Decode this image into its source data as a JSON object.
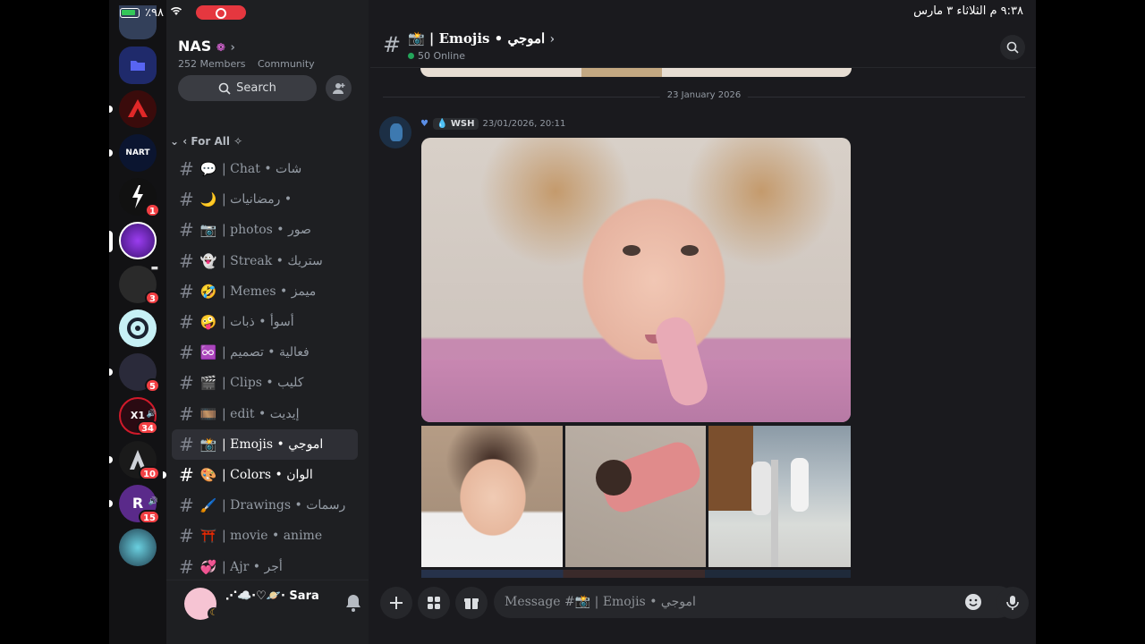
{
  "status_bar": {
    "battery": "٪٩٨",
    "datetime": "٩:٣٨ م  الثلاثاء ٣ مارس"
  },
  "servers": [
    {
      "icon": "folder-icon",
      "color": "#1f2a6b"
    },
    {
      "icon": "server-red",
      "color": "#2a0a0a"
    },
    {
      "icon": "server-nart",
      "color": "#0b1530"
    },
    {
      "icon": "server-1z20",
      "color": "#111",
      "badge": "1"
    },
    {
      "icon": "server-n",
      "color": "#6a2bc2"
    },
    {
      "icon": "server-dark",
      "color": "#2a2a2a",
      "badge": "3"
    },
    {
      "icon": "server-cyan",
      "color": "#c6f0f5"
    },
    {
      "icon": "server-rabbit",
      "color": "#2a2a3a",
      "badge": "5"
    },
    {
      "icon": "server-x1",
      "color": "#2a0a12",
      "badge": "34"
    },
    {
      "icon": "server-a",
      "color": "#1a1a1a",
      "badge": "10"
    },
    {
      "icon": "server-r",
      "color": "#5a2a8a",
      "badge": "15"
    },
    {
      "icon": "server-face",
      "color": "#1e3a4a"
    }
  ],
  "guild": {
    "name": "NAS",
    "members": "252 Members",
    "type": "Community",
    "search_label": "Search"
  },
  "category": "For All",
  "channels": [
    {
      "emoji": "💬",
      "name": "| Chat • شات",
      "state": "normal"
    },
    {
      "emoji": "🌙",
      "name": "| رمضانيات •",
      "state": "normal"
    },
    {
      "emoji": "📷",
      "name": "| photos • صور",
      "state": "normal"
    },
    {
      "emoji": "👻",
      "name": "| Streak • ستريك",
      "state": "normal"
    },
    {
      "emoji": "🤣",
      "name": "| Memes • ميمز",
      "state": "normal"
    },
    {
      "emoji": "🤪",
      "name": "| أسوأ • ذبات",
      "state": "normal"
    },
    {
      "emoji": "♾️",
      "name": "| فعالية • تصميم",
      "state": "normal"
    },
    {
      "emoji": "🎬",
      "name": "| Clips • كليب",
      "state": "normal"
    },
    {
      "emoji": "🎞️",
      "name": "| edit • إيديت",
      "state": "normal"
    },
    {
      "emoji": "📸",
      "name": "| Emojis • اموجي",
      "state": "active"
    },
    {
      "emoji": "🎨",
      "name": "| Colors • الوان",
      "state": "unread"
    },
    {
      "emoji": "🖌️",
      "name": "| Drawings • رسمات",
      "state": "normal"
    },
    {
      "emoji": "⛩️",
      "name": "| movie • anime",
      "state": "normal"
    },
    {
      "emoji": "💞",
      "name": "| Ajr • أجر",
      "state": "normal"
    }
  ],
  "user": {
    "name": "⋰☁️·♡🪐· Sara"
  },
  "main": {
    "channel_title": "📸 | Emojis • اموجي",
    "online": "50 Online",
    "date_divider": "23 January 2026",
    "message": {
      "author_tag": "WSH",
      "timestamp": "23/01/2026, 20:11"
    },
    "composer_placeholder": "Message #📸 | Emojis • اموجي"
  }
}
